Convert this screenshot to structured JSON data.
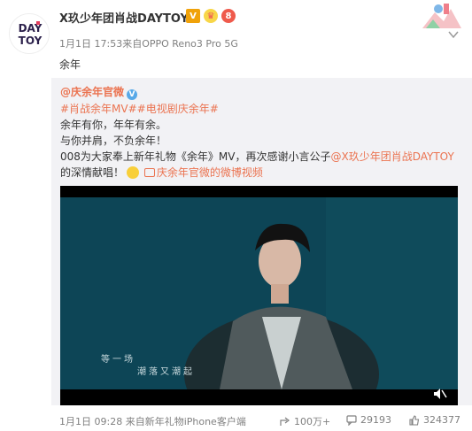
{
  "post": {
    "avatar_text_top": "DAY",
    "avatar_text_bottom": "TOY",
    "author": "X玖少年团肖战DAYTOY",
    "badges": [
      "V",
      "♛",
      "8"
    ],
    "meta": "1月1日 17:53来自OPPO Reno3 Pro 5G",
    "text": "余年"
  },
  "repost": {
    "author": "@庆余年官微",
    "vip_label": "V",
    "tags": "#肖战余年MV##电视剧庆余年#",
    "line1": "余年有你，年年有余。",
    "line2": "与你并肩，不负余年！",
    "line3_prefix": "008为大家奉上新年礼物《余年》MV，再次感谢小言公子",
    "line3_mention": "@X玖少年团肖战DAYTOY",
    "line4_prefix": "的深情献唱！",
    "video_link": "庆余年官微的微博视频",
    "video": {
      "subtitle1": "等一场",
      "subtitle2": "潮落又潮起"
    }
  },
  "footer": {
    "meta": "1月1日 09:28 来自新年礼物iPhone客户端",
    "forward_count": "100万+",
    "comment_count": "29193",
    "like_count": "324377",
    "icons": {
      "forward": "share-icon",
      "comment": "comment-icon",
      "like": "thumbs-up-icon"
    }
  },
  "colors": {
    "accent": "#eb7350",
    "repost_bg": "#f2f2f5",
    "muted_text": "#808080"
  }
}
